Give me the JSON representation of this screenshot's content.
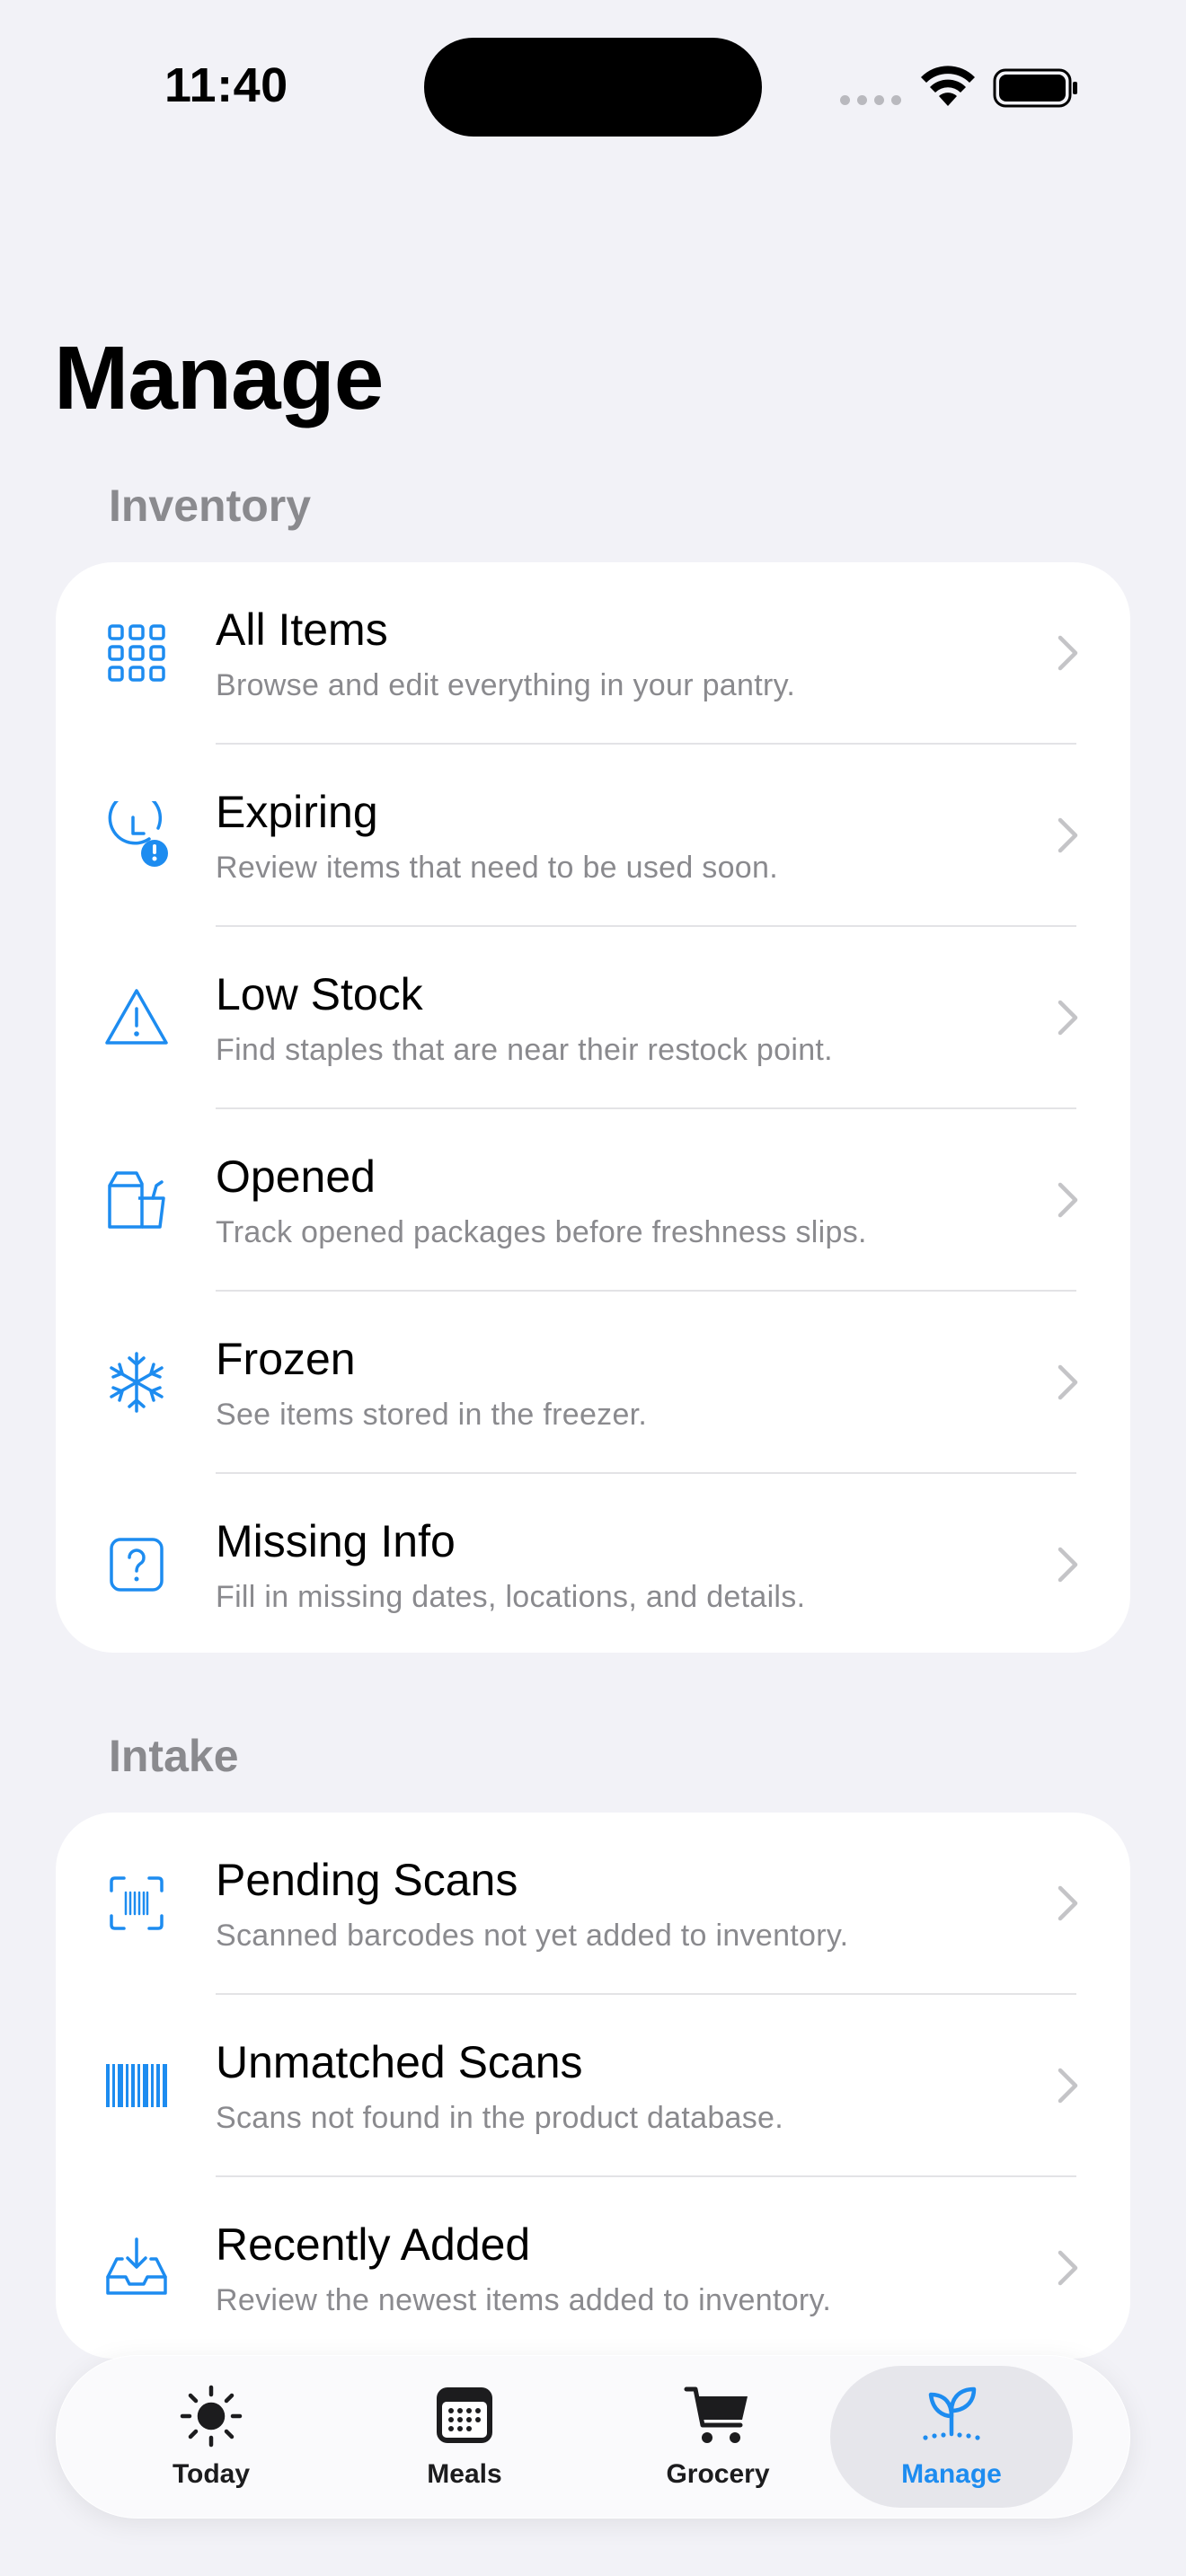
{
  "status": {
    "time": "11:40"
  },
  "page": {
    "title": "Manage"
  },
  "sections": [
    {
      "header": "Inventory",
      "items": [
        {
          "title": "All Items",
          "subtitle": "Browse and edit everything in your pantry.",
          "icon": "grid-icon"
        },
        {
          "title": "Expiring",
          "subtitle": "Review items that need to be used soon.",
          "icon": "clock-alert-icon"
        },
        {
          "title": "Low Stock",
          "subtitle": "Find staples that are near their restock point.",
          "icon": "warning-triangle-icon"
        },
        {
          "title": "Opened",
          "subtitle": "Track opened packages before freshness slips.",
          "icon": "opened-package-icon"
        },
        {
          "title": "Frozen",
          "subtitle": "See items stored in the freezer.",
          "icon": "snowflake-icon"
        },
        {
          "title": "Missing Info",
          "subtitle": "Fill in missing dates, locations, and details.",
          "icon": "question-square-icon"
        }
      ]
    },
    {
      "header": "Intake",
      "items": [
        {
          "title": "Pending Scans",
          "subtitle": "Scanned barcodes not yet added to inventory.",
          "icon": "barcode-viewfinder-icon"
        },
        {
          "title": "Unmatched Scans",
          "subtitle": "Scans not found in the product database.",
          "icon": "barcode-icon"
        },
        {
          "title": "Recently Added",
          "subtitle": "Review the newest items added to inventory.",
          "icon": "tray-download-icon"
        }
      ]
    }
  ],
  "tabbar": {
    "tabs": [
      {
        "label": "Today",
        "icon": "sun-icon"
      },
      {
        "label": "Meals",
        "icon": "calendar-icon"
      },
      {
        "label": "Grocery",
        "icon": "cart-icon"
      },
      {
        "label": "Manage",
        "icon": "sprout-icon",
        "active": true
      }
    ]
  },
  "colors": {
    "accent": "#1D8CF0",
    "background": "#F2F2F7",
    "card": "#FFFFFF",
    "secondary_text": "#8A8A8E"
  }
}
